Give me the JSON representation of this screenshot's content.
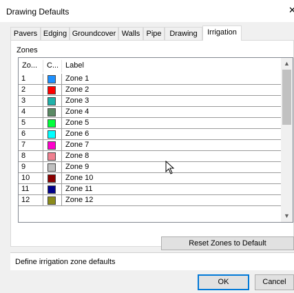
{
  "window": {
    "title": "Drawing Defaults",
    "close_glyph": "✕"
  },
  "tabs": [
    {
      "label": "Pavers"
    },
    {
      "label": "Edging"
    },
    {
      "label": "Groundcover"
    },
    {
      "label": "Walls"
    },
    {
      "label": "Pipe"
    },
    {
      "label": "Drawing"
    },
    {
      "label": "Irrigation",
      "active": true
    }
  ],
  "zones": {
    "section_label": "Zones",
    "columns": [
      "Zo...",
      "C...",
      "Label"
    ],
    "rows": [
      {
        "id": "1",
        "color": "#1e90ff",
        "label": "Zone 1"
      },
      {
        "id": "2",
        "color": "#ff0000",
        "label": "Zone 2"
      },
      {
        "id": "3",
        "color": "#20b2aa",
        "label": "Zone 3"
      },
      {
        "id": "4",
        "color": "#5a8a64",
        "label": "Zone 4"
      },
      {
        "id": "5",
        "color": "#00ff3c",
        "label": "Zone 5"
      },
      {
        "id": "6",
        "color": "#00ffff",
        "label": "Zone 6"
      },
      {
        "id": "7",
        "color": "#ff00cc",
        "label": "Zone 7"
      },
      {
        "id": "8",
        "color": "#f08090",
        "label": "Zone 8"
      },
      {
        "id": "9",
        "color": "#c0c0c0",
        "label": "Zone 9"
      },
      {
        "id": "10",
        "color": "#8b0000",
        "label": "Zone 10"
      },
      {
        "id": "11",
        "color": "#00008b",
        "label": "Zone 11"
      },
      {
        "id": "12",
        "color": "#8b8b1a",
        "label": "Zone 12"
      }
    ],
    "scroll_up_glyph": "▲",
    "scroll_down_glyph": "▼"
  },
  "buttons": {
    "reset": "Reset Zones to Default",
    "ok": "OK",
    "cancel": "Cancel"
  },
  "description": "Define irrigation zone defaults"
}
